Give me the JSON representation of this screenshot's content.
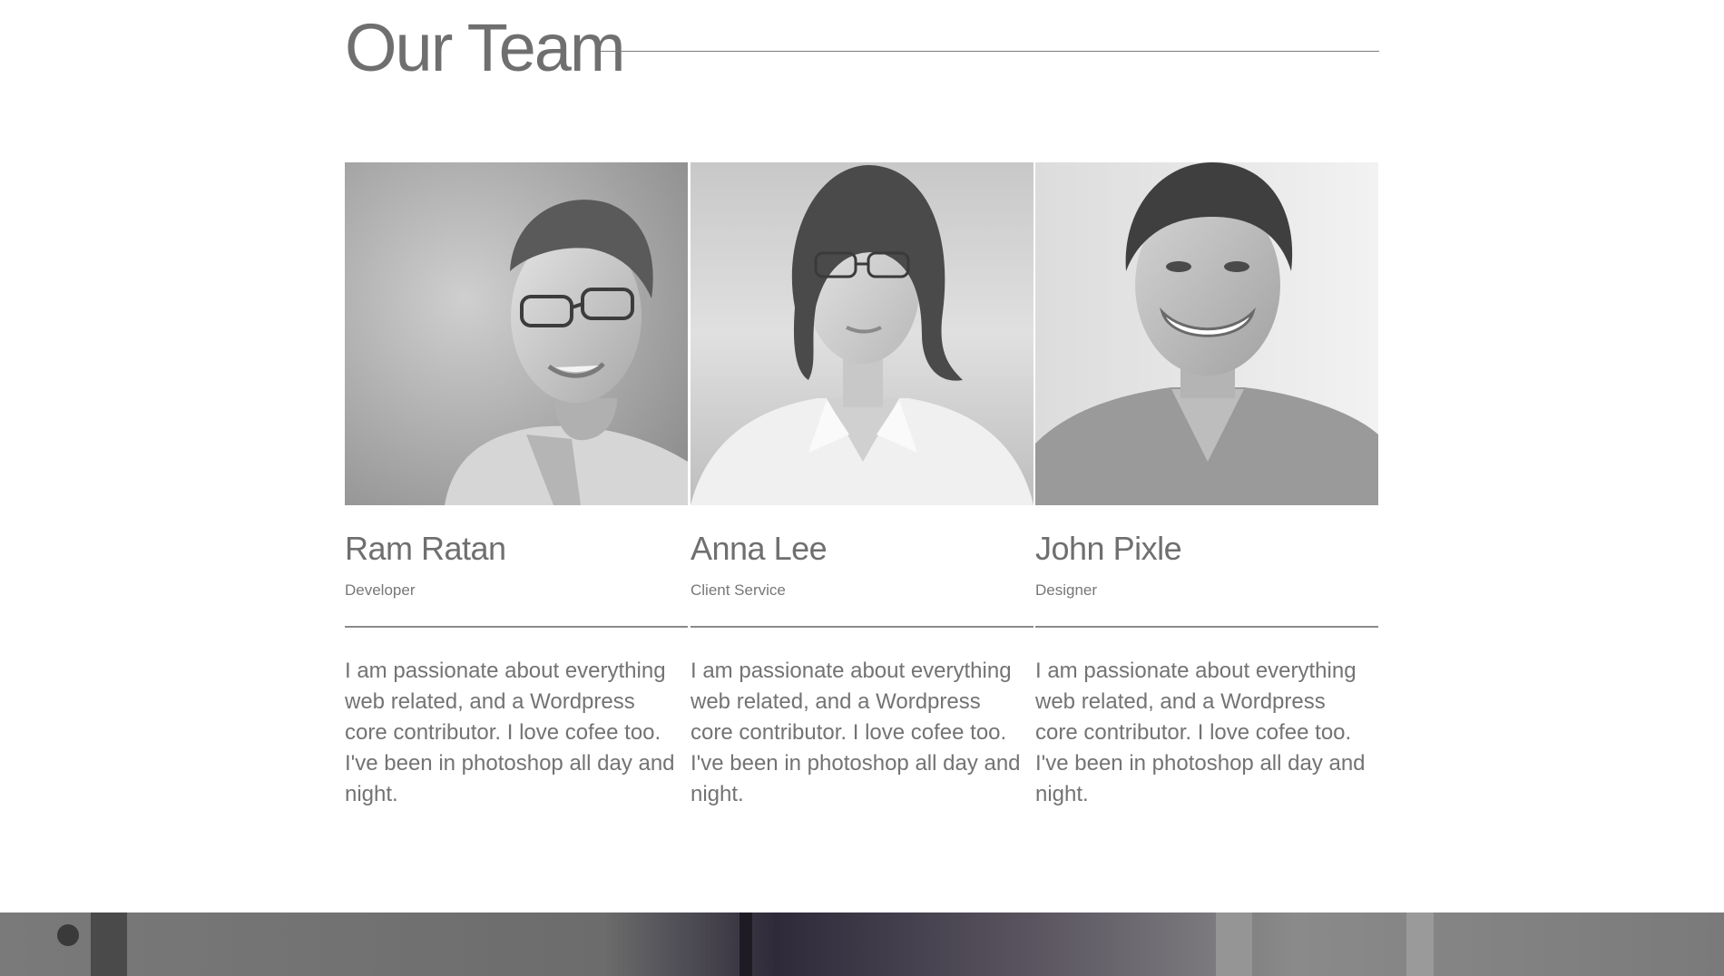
{
  "section": {
    "title": "Our Team"
  },
  "team": [
    {
      "name": "Ram Ratan",
      "role": "Developer",
      "bio": "I am passionate about everything web related, and a Wordpress core contributor. I love cofee too. I've been in photoshop all day and night."
    },
    {
      "name": "Anna Lee",
      "role": "Client Service",
      "bio": "I am passionate about everything web related, and a Wordpress core contributor. I love cofee too. I've been in photoshop all day and night."
    },
    {
      "name": "John Pixle",
      "role": "Designer",
      "bio": "I am passionate about everything web related, and a Wordpress core contributor. I love cofee too. I've been in photoshop all day and night."
    }
  ],
  "colors": {
    "text": "#707070",
    "rule": "#8a8a8a",
    "background": "#ffffff"
  }
}
